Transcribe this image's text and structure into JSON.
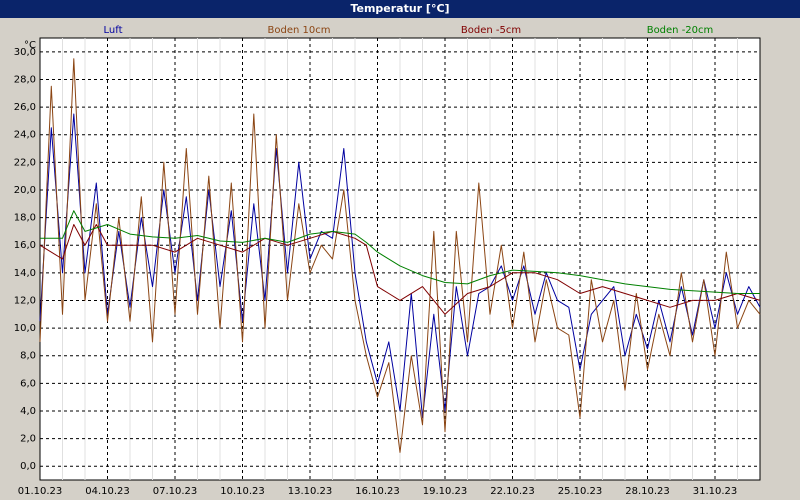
{
  "window": {
    "title": "Temperatur [°C]"
  },
  "chart_data": {
    "type": "line",
    "ylabel": "°C",
    "ylim": [
      -1,
      31
    ],
    "y_ticks": [
      "0,0",
      "2,0",
      "4,0",
      "6,0",
      "8,0",
      "10,0",
      "12,0",
      "14,0",
      "16,0",
      "18,0",
      "20,0",
      "22,0",
      "24,0",
      "26,0",
      "28,0",
      "30,0"
    ],
    "x_ticks": [
      "01.10.23",
      "04.10.23",
      "07.10.23",
      "10.10.23",
      "13.10.23",
      "16.10.23",
      "19.10.23",
      "22.10.23",
      "25.10.23",
      "28.10.23",
      "31.10.23"
    ],
    "xlim_days": [
      0,
      32
    ],
    "grid": true,
    "legend": "top",
    "series": [
      {
        "name": "Luft",
        "color": "#0000a0",
        "x": [
          0,
          0.5,
          1,
          1.5,
          2,
          2.5,
          3,
          3.5,
          4,
          4.5,
          5,
          5.5,
          6,
          6.5,
          7,
          7.5,
          8,
          8.5,
          9,
          9.5,
          10,
          10.5,
          11,
          11.5,
          12,
          12.5,
          13,
          13.5,
          14,
          14.5,
          15,
          15.5,
          16,
          16.5,
          17,
          17.5,
          18,
          18.5,
          19,
          19.5,
          20,
          20.5,
          21,
          21.5,
          22,
          22.5,
          23,
          23.5,
          24,
          24.5,
          25,
          25.5,
          26,
          26.5,
          27,
          27.5,
          28,
          28.5,
          29,
          29.5,
          30,
          30.5,
          31,
          31.5,
          32
        ],
        "y": [
          10.5,
          24.5,
          14,
          25.5,
          14,
          20.5,
          11,
          17,
          11.5,
          18,
          13,
          20,
          14,
          19.5,
          12,
          20,
          13,
          18.5,
          10.5,
          19,
          12,
          23,
          14,
          22,
          15,
          17,
          16.5,
          23,
          14,
          9,
          6,
          9,
          4,
          12.5,
          3.5,
          11,
          4,
          13,
          8,
          12.5,
          13,
          14.5,
          12,
          14.5,
          11,
          14,
          12,
          11.5,
          7,
          11,
          12,
          13,
          8,
          11,
          8.5,
          12,
          9,
          13,
          9.5,
          13.5,
          10,
          14,
          11,
          13,
          11.5
        ]
      },
      {
        "name": "Boden 10cm",
        "color": "#8b4513",
        "x": [
          0,
          0.5,
          1,
          1.5,
          2,
          2.5,
          3,
          3.5,
          4,
          4.5,
          5,
          5.5,
          6,
          6.5,
          7,
          7.5,
          8,
          8.5,
          9,
          9.5,
          10,
          10.5,
          11,
          11.5,
          12,
          12.5,
          13,
          13.5,
          14,
          14.5,
          15,
          15.5,
          16,
          16.5,
          17,
          17.5,
          18,
          18.5,
          19,
          19.5,
          20,
          20.5,
          21,
          21.5,
          22,
          22.5,
          23,
          23.5,
          24,
          24.5,
          25,
          25.5,
          26,
          26.5,
          27,
          27.5,
          28,
          28.5,
          29,
          29.5,
          30,
          30.5,
          31,
          31.5,
          32
        ],
        "y": [
          9,
          27.5,
          11,
          29.5,
          12,
          19,
          10.5,
          18,
          10.5,
          19.5,
          9,
          22,
          11,
          23,
          11,
          21,
          10,
          20.5,
          9,
          25.5,
          10,
          24,
          12,
          19,
          14,
          16,
          15,
          20,
          12,
          8,
          5,
          7.5,
          1,
          8,
          3,
          17,
          2.5,
          17,
          9,
          20.5,
          11,
          16,
          10,
          15.5,
          9,
          13.5,
          10,
          9.5,
          3.5,
          13.5,
          9,
          12,
          5.5,
          12.5,
          7,
          11,
          8,
          14,
          9,
          13.5,
          8,
          15.5,
          10,
          12,
          11
        ]
      },
      {
        "name": "Boden -5cm",
        "color": "#800000",
        "x": [
          0,
          1,
          1.5,
          2,
          2.5,
          3,
          4,
          5,
          6,
          7,
          8,
          9,
          10,
          11,
          12,
          13,
          14,
          14.5,
          15,
          15.5,
          16,
          17,
          18,
          19,
          20,
          21,
          22,
          23,
          24,
          25,
          26,
          27,
          28,
          29,
          30,
          31,
          32
        ],
        "y": [
          16,
          15,
          17.5,
          16,
          17.5,
          16,
          16,
          16,
          15.5,
          16.5,
          16,
          15.5,
          16.5,
          16,
          16.5,
          17,
          16.5,
          16,
          13,
          12.5,
          12,
          13,
          11,
          12.5,
          13,
          14,
          14,
          13.5,
          12.5,
          13,
          12.5,
          12,
          11.5,
          12,
          12,
          12.5,
          12
        ]
      },
      {
        "name": "Boden -20cm",
        "color": "#008000",
        "x": [
          0,
          1,
          1.5,
          2,
          3,
          4,
          5,
          6,
          7,
          8,
          9,
          10,
          11,
          12,
          13,
          14,
          14.5,
          15,
          16,
          17,
          18,
          19,
          20,
          21,
          22,
          23,
          24,
          25,
          26,
          27,
          28,
          29,
          30,
          31,
          32
        ],
        "y": [
          16.5,
          16.5,
          18.5,
          17,
          17.5,
          16.8,
          16.6,
          16.5,
          16.7,
          16.3,
          16.2,
          16.5,
          16.2,
          16.8,
          17,
          16.8,
          16.2,
          15.5,
          14.5,
          13.8,
          13.3,
          13.2,
          13.8,
          14.2,
          14.1,
          14,
          13.8,
          13.5,
          13.2,
          13,
          12.8,
          12.7,
          12.6,
          12.5,
          12.5
        ]
      }
    ]
  }
}
